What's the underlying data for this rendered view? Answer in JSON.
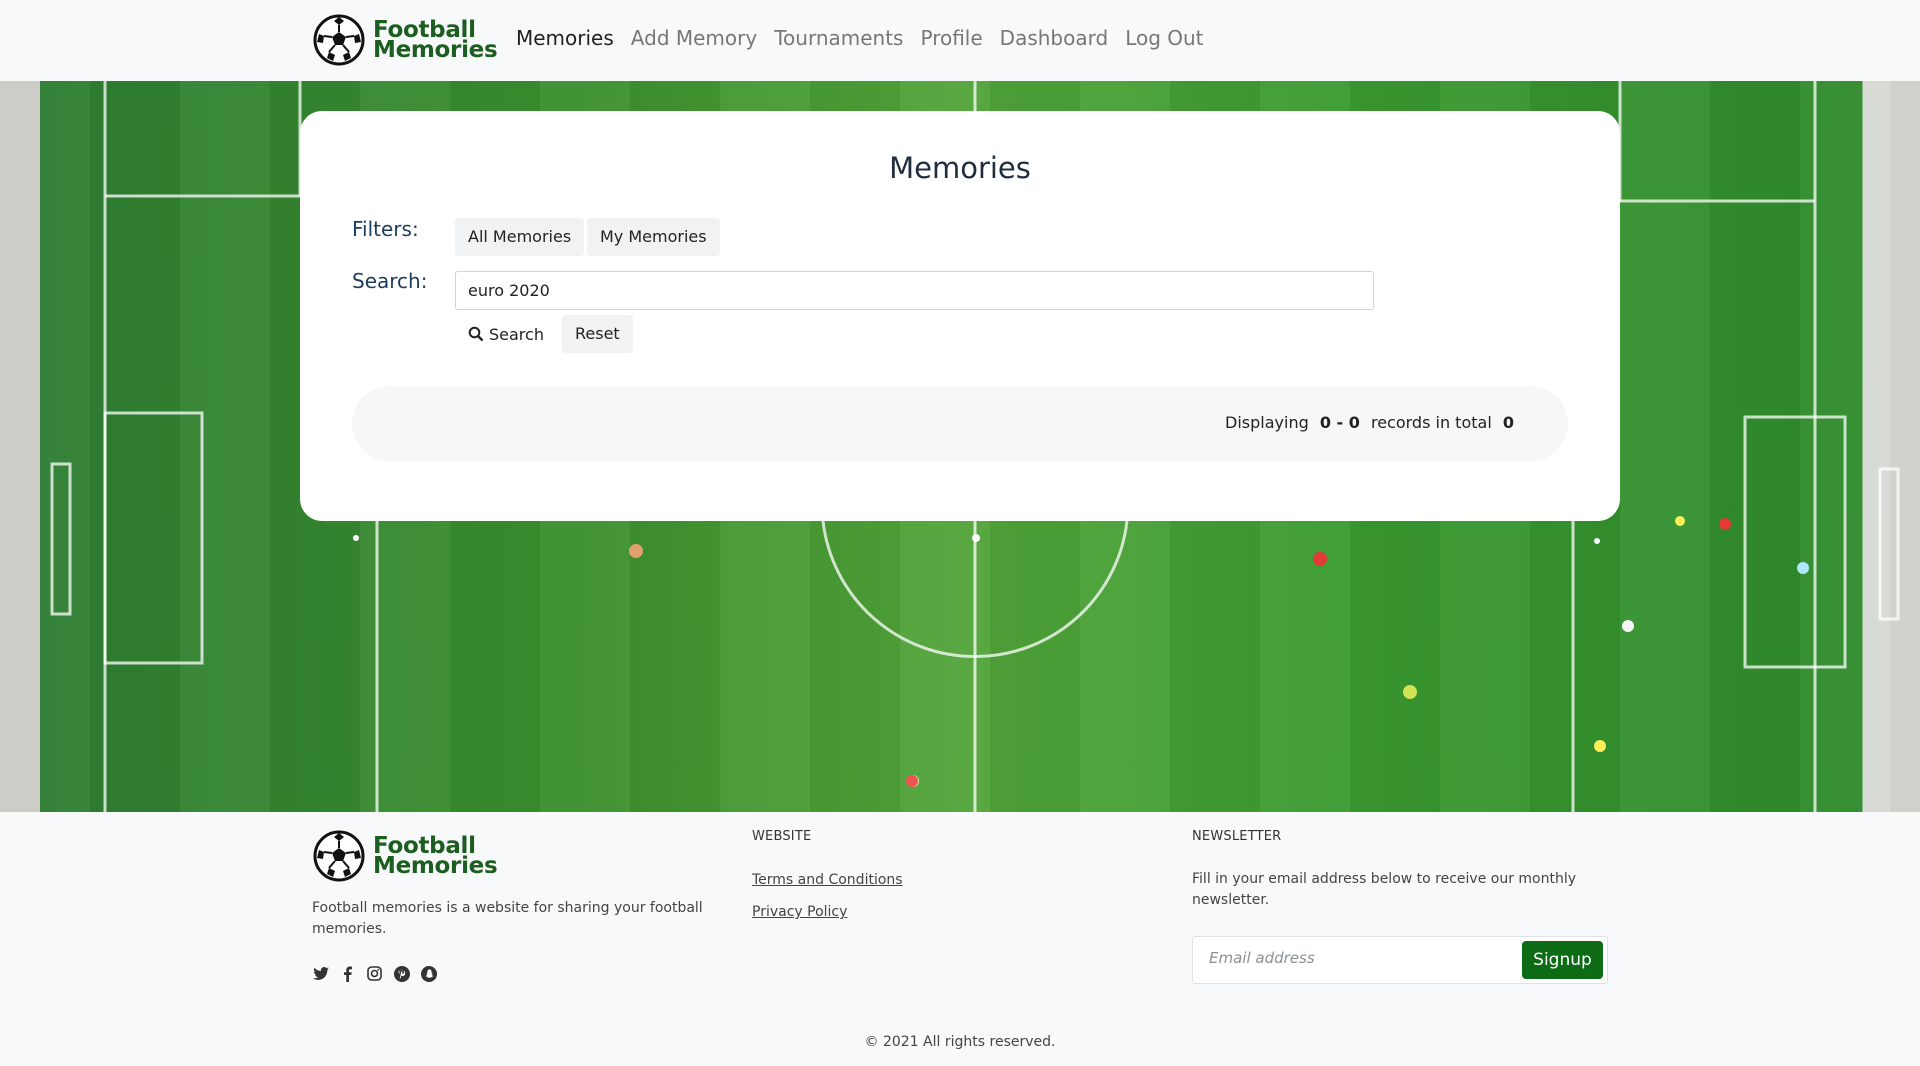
{
  "brand": {
    "line1": "Football",
    "line2": "Memories"
  },
  "nav": {
    "items": [
      {
        "label": "Memories"
      },
      {
        "label": "Add Memory"
      },
      {
        "label": "Tournaments"
      },
      {
        "label": "Profile"
      },
      {
        "label": "Dashboard"
      },
      {
        "label": "Log Out"
      }
    ]
  },
  "main": {
    "title": "Memories",
    "filters_label": "Filters:",
    "filter_all": "All Memories",
    "filter_my": "My Memories",
    "search_label": "Search:",
    "search_value": "euro 2020",
    "search_button": "Search",
    "reset_button": "Reset",
    "results": {
      "prefix": "Displaying",
      "range": "0 - 0",
      "middle": "records in total",
      "total": "0"
    }
  },
  "footer": {
    "description": "Football memories is a website for sharing your football memories.",
    "socials": [
      "twitter-icon",
      "facebook-icon",
      "instagram-icon",
      "pinterest-icon",
      "snapchat-icon"
    ],
    "website_heading": "WEBSITE",
    "links": [
      "Terms and Conditions",
      "Privacy Policy"
    ],
    "newsletter_heading": "NEWSLETTER",
    "newsletter_text": "Fill in your email address below to receive our monthly newsletter.",
    "email_placeholder": "Email address",
    "signup_label": "Signup",
    "copyright": "© 2021 All rights reserved."
  },
  "colors": {
    "brand_green": "#1b5e20",
    "signup_green": "#0d6b15",
    "nav_active": "#222222"
  }
}
